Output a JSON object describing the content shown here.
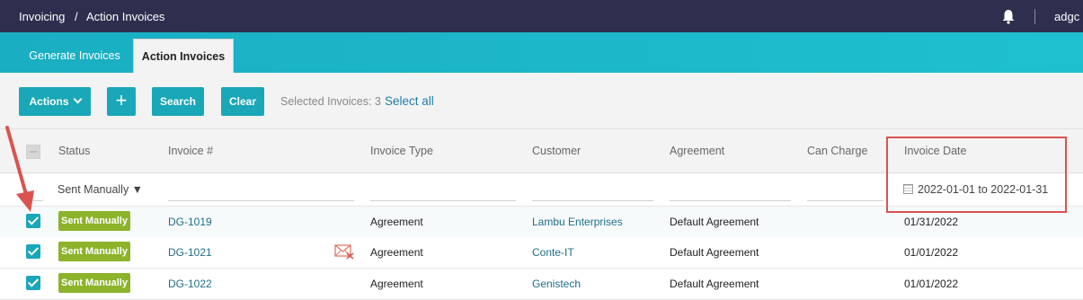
{
  "breadcrumb": {
    "root": "Invoicing",
    "separator": "/",
    "current": "Action Invoices"
  },
  "header": {
    "user": "adgc",
    "bell_icon": "bell-icon"
  },
  "tabs": [
    {
      "label": "Generate Invoices",
      "active": false
    },
    {
      "label": "Action Invoices",
      "active": true
    }
  ],
  "toolbar": {
    "actions_label": "Actions",
    "add_label": "+",
    "search_label": "Search",
    "clear_label": "Clear",
    "selected_text": "Selected Invoices: 3",
    "select_all_label": "Select all"
  },
  "table": {
    "columns": [
      "Status",
      "Invoice #",
      "Invoice Type",
      "Customer",
      "Agreement",
      "Can Charge",
      "Invoice Date"
    ],
    "filters": {
      "status": "Sent Manually ▼",
      "invoice_date": "2022-01-01 to 2022-01-31"
    },
    "rows": [
      {
        "status": "Sent Manually",
        "invoice": "DG-1019",
        "type": "Agreement",
        "customer": "Lambu Enterprises",
        "agreement": "Default Agreement",
        "can_charge": "",
        "date": "01/31/2022",
        "mail_icon": false
      },
      {
        "status": "Sent Manually",
        "invoice": "DG-1021",
        "type": "Agreement",
        "customer": "Conte-IT",
        "agreement": "Default Agreement",
        "can_charge": "",
        "date": "01/01/2022",
        "mail_icon": true
      },
      {
        "status": "Sent Manually",
        "invoice": "DG-1022",
        "type": "Agreement",
        "customer": "Genistech",
        "agreement": "Default Agreement",
        "can_charge": "",
        "date": "01/01/2022",
        "mail_icon": false
      }
    ]
  },
  "colors": {
    "topbar": "#2e2f4f",
    "accent": "#1aa7b8",
    "status_green": "#8cb32a",
    "annotation_red": "#d9534f"
  }
}
